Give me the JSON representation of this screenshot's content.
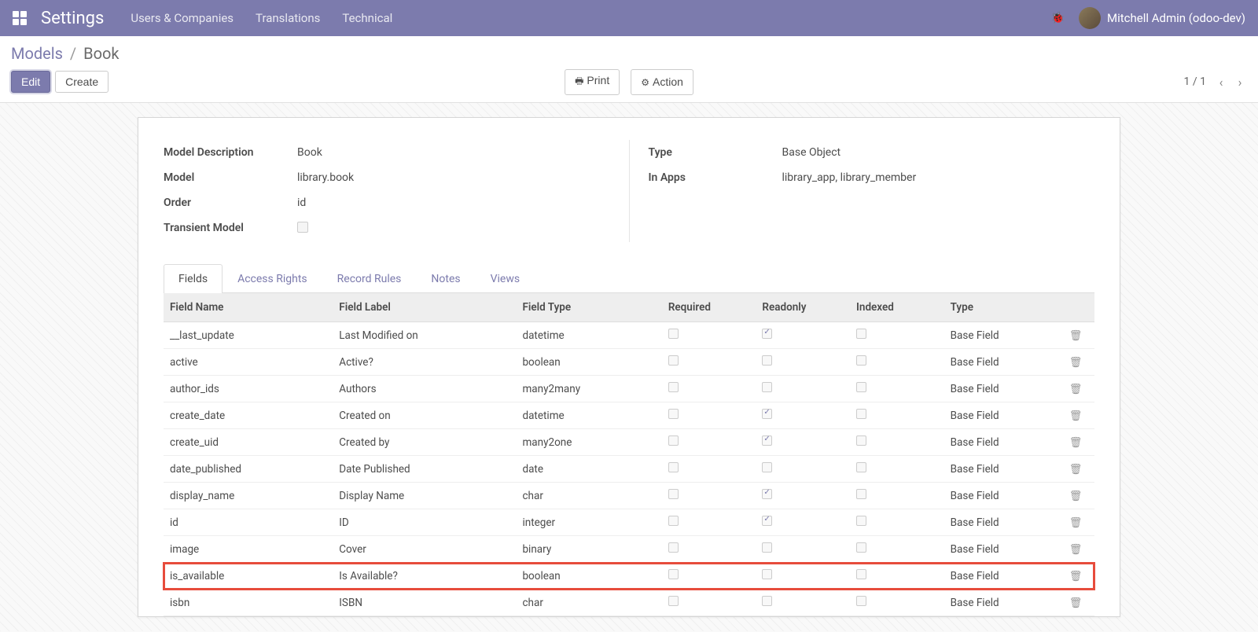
{
  "navbar": {
    "title": "Settings",
    "menu": [
      "Users & Companies",
      "Translations",
      "Technical"
    ],
    "user": "Mitchell Admin (odoo-dev)"
  },
  "breadcrumb": {
    "parent": "Models",
    "current": "Book"
  },
  "buttons": {
    "edit": "Edit",
    "create": "Create",
    "print": "Print",
    "action": "Action"
  },
  "pager": {
    "text": "1 / 1"
  },
  "form": {
    "left": [
      {
        "label": "Model Description",
        "value": "Book"
      },
      {
        "label": "Model",
        "value": "library.book"
      },
      {
        "label": "Order",
        "value": "id"
      },
      {
        "label": "Transient Model",
        "value": "",
        "checkbox": true,
        "checked": false
      }
    ],
    "right": [
      {
        "label": "Type",
        "value": "Base Object"
      },
      {
        "label": "In Apps",
        "value": "library_app, library_member"
      }
    ]
  },
  "tabs": [
    "Fields",
    "Access Rights",
    "Record Rules",
    "Notes",
    "Views"
  ],
  "active_tab": 0,
  "table": {
    "headers": [
      "Field Name",
      "Field Label",
      "Field Type",
      "Required",
      "Readonly",
      "Indexed",
      "Type",
      ""
    ],
    "rows": [
      {
        "name": "__last_update",
        "label": "Last Modified on",
        "ftype": "datetime",
        "required": false,
        "readonly": true,
        "indexed": false,
        "type": "Base Field",
        "highlight": false
      },
      {
        "name": "active",
        "label": "Active?",
        "ftype": "boolean",
        "required": false,
        "readonly": false,
        "indexed": false,
        "type": "Base Field",
        "highlight": false
      },
      {
        "name": "author_ids",
        "label": "Authors",
        "ftype": "many2many",
        "required": false,
        "readonly": false,
        "indexed": false,
        "type": "Base Field",
        "highlight": false
      },
      {
        "name": "create_date",
        "label": "Created on",
        "ftype": "datetime",
        "required": false,
        "readonly": true,
        "indexed": false,
        "type": "Base Field",
        "highlight": false
      },
      {
        "name": "create_uid",
        "label": "Created by",
        "ftype": "many2one",
        "required": false,
        "readonly": true,
        "indexed": false,
        "type": "Base Field",
        "highlight": false
      },
      {
        "name": "date_published",
        "label": "Date Published",
        "ftype": "date",
        "required": false,
        "readonly": false,
        "indexed": false,
        "type": "Base Field",
        "highlight": false
      },
      {
        "name": "display_name",
        "label": "Display Name",
        "ftype": "char",
        "required": false,
        "readonly": true,
        "indexed": false,
        "type": "Base Field",
        "highlight": false
      },
      {
        "name": "id",
        "label": "ID",
        "ftype": "integer",
        "required": false,
        "readonly": true,
        "indexed": false,
        "type": "Base Field",
        "highlight": false
      },
      {
        "name": "image",
        "label": "Cover",
        "ftype": "binary",
        "required": false,
        "readonly": false,
        "indexed": false,
        "type": "Base Field",
        "highlight": false
      },
      {
        "name": "is_available",
        "label": "Is Available?",
        "ftype": "boolean",
        "required": false,
        "readonly": false,
        "indexed": false,
        "type": "Base Field",
        "highlight": true
      },
      {
        "name": "isbn",
        "label": "ISBN",
        "ftype": "char",
        "required": false,
        "readonly": false,
        "indexed": false,
        "type": "Base Field",
        "highlight": false
      }
    ]
  }
}
